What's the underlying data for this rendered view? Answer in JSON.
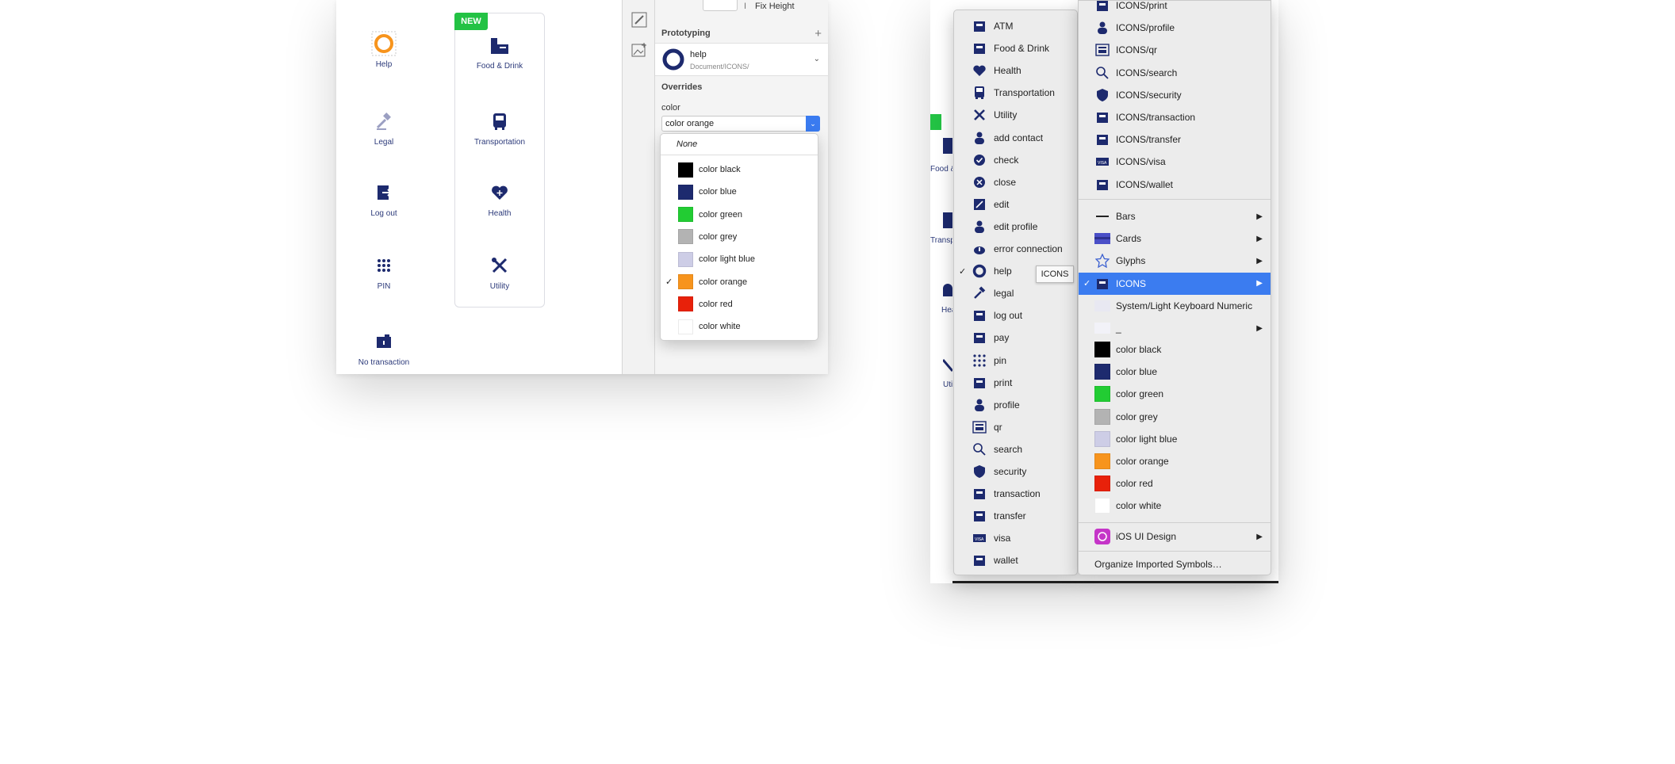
{
  "left_panel": {
    "artboard_items": [
      {
        "label": "Help",
        "icon": "help-icon"
      },
      {
        "label": "Food & Drink",
        "icon": "food-drink-icon"
      },
      {
        "label": "Legal",
        "icon": "legal-icon"
      },
      {
        "label": "Transportation",
        "icon": "transportation-icon"
      },
      {
        "label": "Log out",
        "icon": "log-out-icon"
      },
      {
        "label": "Health",
        "icon": "health-icon"
      },
      {
        "label": "PIN",
        "icon": "pin-icon"
      },
      {
        "label": "Utility",
        "icon": "utility-icon"
      },
      {
        "label": "No transaction",
        "icon": "no-transaction-icon"
      }
    ],
    "new_badge": "NEW"
  },
  "inspector": {
    "fix_height_label": "Fix Height",
    "prototyping_title": "Prototyping",
    "symbol": {
      "name": "help",
      "path": "Document/ICONS/"
    },
    "overrides_title": "Overrides",
    "color_label": "color",
    "color_value": "color orange"
  },
  "color_dropdown": {
    "none_label": "None",
    "items": [
      {
        "label": "color black",
        "color": "#000000",
        "checked": false
      },
      {
        "label": "color blue",
        "color": "#1d2a6e",
        "checked": false
      },
      {
        "label": "color green",
        "color": "#22cc33",
        "checked": false
      },
      {
        "label": "color grey",
        "color": "#b3b3b3",
        "checked": false
      },
      {
        "label": "color light blue",
        "color": "#cdcde6",
        "checked": false
      },
      {
        "label": "color orange",
        "color": "#f7941d",
        "checked": true
      },
      {
        "label": "color red",
        "color": "#e8210a",
        "checked": false
      },
      {
        "label": "color white",
        "color": "#ffffff",
        "checked": false
      }
    ],
    "check_mark": "✓"
  },
  "right_peek": [
    "Food &",
    "Transp",
    "Hea",
    "Uti"
  ],
  "submenu_icons": {
    "items": [
      "ATM",
      "Food & Drink",
      "Health",
      "Transportation",
      "Utility",
      "add contact",
      "check",
      "close",
      "edit",
      "edit profile",
      "error connection",
      "help",
      "legal",
      "log out",
      "pay",
      "pin",
      "print",
      "profile",
      "qr",
      "search",
      "security",
      "transaction",
      "transfer",
      "visa",
      "wallet"
    ],
    "checked_item": "help",
    "tooltip": "ICONS"
  },
  "symbols_menu": {
    "top_items": [
      "ICONS/print",
      "ICONS/profile",
      "ICONS/qr",
      "ICONS/search",
      "ICONS/security",
      "ICONS/transaction",
      "ICONS/transfer",
      "ICONS/visa",
      "ICONS/wallet"
    ],
    "groups": [
      {
        "label": "Bars",
        "has_arrow": true
      },
      {
        "label": "Cards",
        "has_arrow": true
      },
      {
        "label": "Glyphs",
        "has_arrow": true
      },
      {
        "label": "ICONS",
        "has_arrow": true,
        "selected": true
      },
      {
        "label": "System/Light Keyboard Numeric",
        "has_arrow": false
      },
      {
        "label": "_",
        "has_arrow": true
      }
    ],
    "colors": [
      {
        "label": "color black",
        "color": "#000000"
      },
      {
        "label": "color blue",
        "color": "#1d2a6e"
      },
      {
        "label": "color green",
        "color": "#22cc33"
      },
      {
        "label": "color grey",
        "color": "#b3b3b3"
      },
      {
        "label": "color light blue",
        "color": "#cdcde6"
      },
      {
        "label": "color orange",
        "color": "#f7941d"
      },
      {
        "label": "color red",
        "color": "#e8210a"
      },
      {
        "label": "color white",
        "color": "#ffffff"
      }
    ],
    "library": "iOS UI Design",
    "organize": "Organize Imported Symbols…",
    "arrow": "▶",
    "check_mark": "✓"
  }
}
